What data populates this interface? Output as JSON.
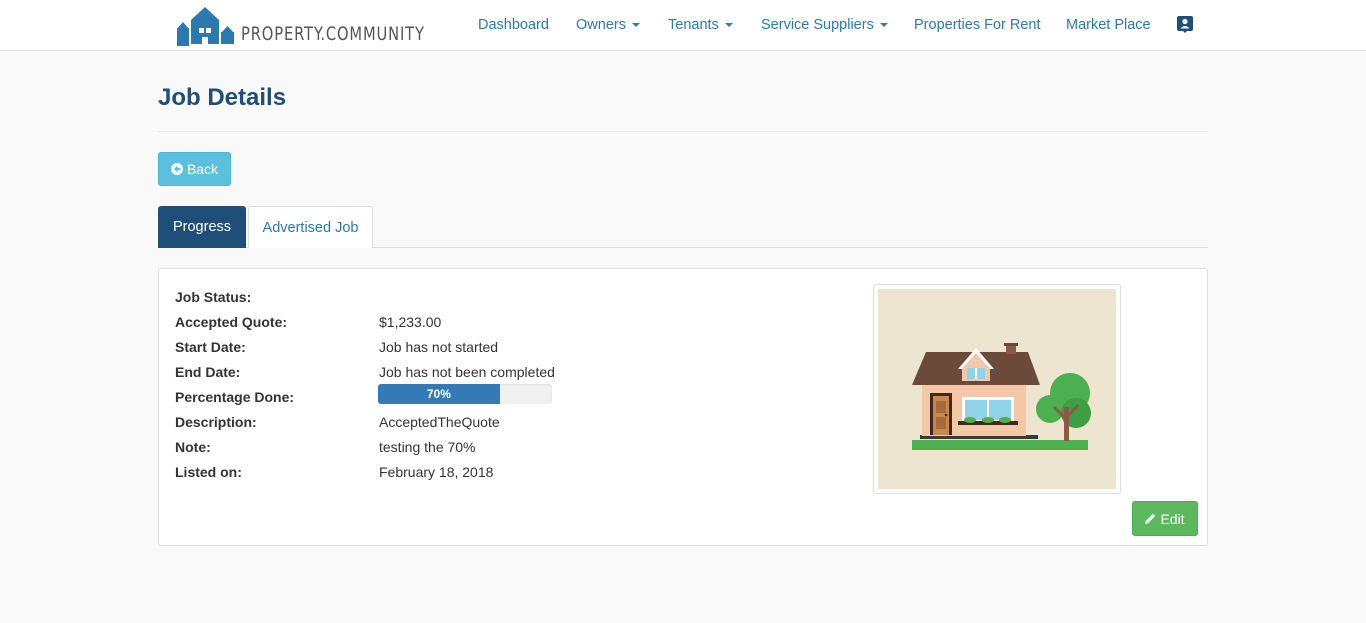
{
  "brand": {
    "name": "PROPERTY.COMMUNITY"
  },
  "nav": {
    "items": [
      {
        "label": "Dashboard",
        "dropdown": false
      },
      {
        "label": "Owners",
        "dropdown": true
      },
      {
        "label": "Tenants",
        "dropdown": true
      },
      {
        "label": "Service Suppliers",
        "dropdown": true
      },
      {
        "label": "Properties For Rent",
        "dropdown": false
      },
      {
        "label": "Market Place",
        "dropdown": false
      }
    ],
    "profile_icon": "profile-icon"
  },
  "page": {
    "title": "Job Details"
  },
  "back_button": {
    "label": "Back",
    "icon": "arrow-left-icon"
  },
  "tabs": [
    {
      "label": "Progress",
      "active": true
    },
    {
      "label": "Advertised Job",
      "active": false
    }
  ],
  "details": {
    "job_status": {
      "label": "Job Status:",
      "value": ""
    },
    "accepted_quote": {
      "label": "Accepted Quote:",
      "value": "$1,233.00"
    },
    "start_date": {
      "label": "Start Date:",
      "value": "Job has not started"
    },
    "end_date": {
      "label": "End Date:",
      "value": "Job has not been completed"
    },
    "percentage_done": {
      "label": "Percentage Done:",
      "value": "70%",
      "fraction": 0.7
    },
    "description": {
      "label": "Description:",
      "value": "AcceptedTheQuote"
    },
    "note": {
      "label": "Note:",
      "value": "testing the 70%"
    },
    "listed_on": {
      "label": "Listed on:",
      "value": "February 18, 2018"
    }
  },
  "edit_button": {
    "label": "Edit",
    "icon": "pencil-icon"
  },
  "colors": {
    "brand_blue": "#1f4e79",
    "link": "#2a7ab0",
    "info": "#5bc0de",
    "success": "#5cb85c",
    "progress": "#337ab7"
  }
}
